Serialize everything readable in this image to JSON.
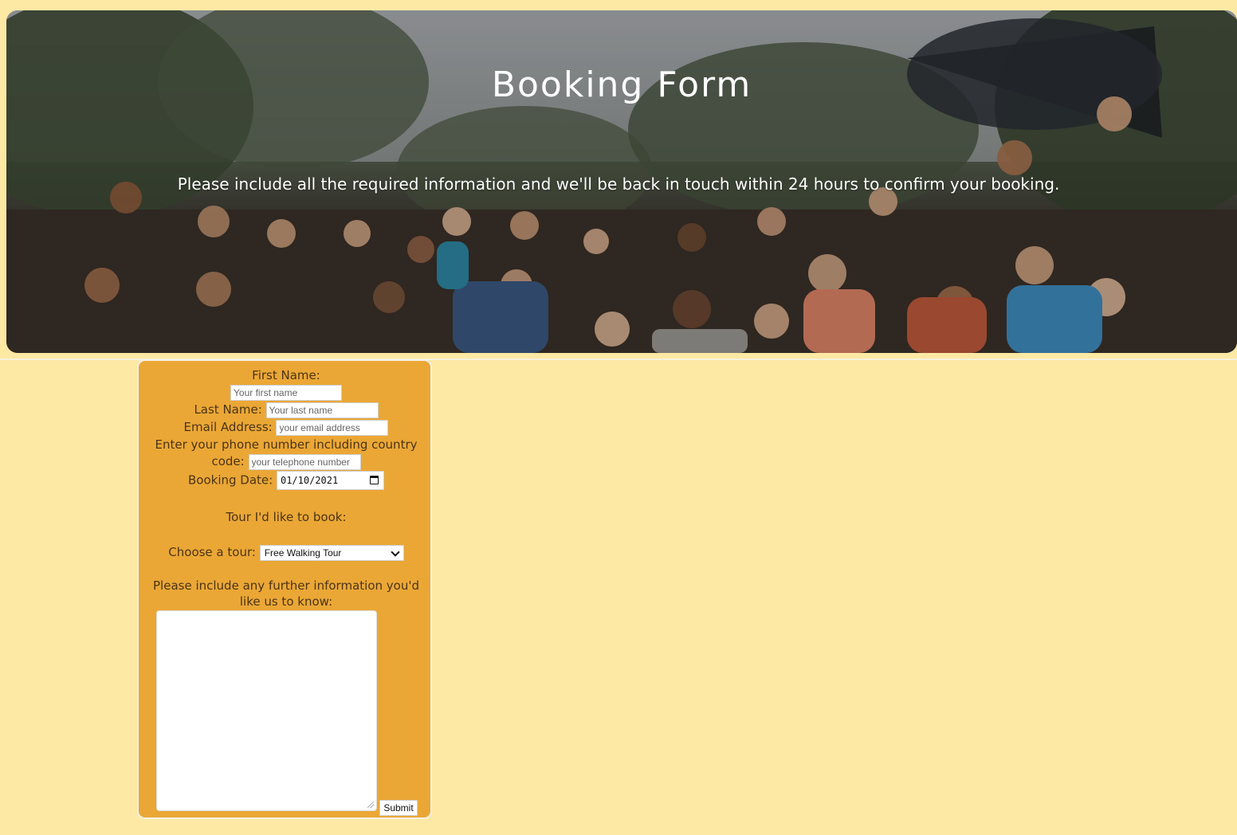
{
  "hero": {
    "title": "Booking Form",
    "subtitle": "Please include all the required information and we'll be back in touch within 24 hours to confirm your booking."
  },
  "form": {
    "first_name_label": "First Name:",
    "first_name_placeholder": "Your first name",
    "last_name_label": "Last Name:",
    "last_name_placeholder": "Your last name",
    "email_label": "Email Address:",
    "email_placeholder": "your email address",
    "phone_label_line1": "Enter your phone number including country",
    "phone_label_line2": "code:",
    "phone_placeholder": "your telephone number",
    "booking_date_label": "Booking Date:",
    "booking_date_value": "01/10/2021",
    "tour_heading": "Tour I'd like to book:",
    "choose_tour_label": "Choose a tour:",
    "tour_selected": "Free Walking Tour",
    "further_info_line1": "Please include any further information you'd",
    "further_info_line2": "like us to know:",
    "submit_label": "Submit"
  },
  "colors": {
    "page_background": "#fde9a4",
    "form_background": "#eba735",
    "form_text": "#4a3418"
  }
}
